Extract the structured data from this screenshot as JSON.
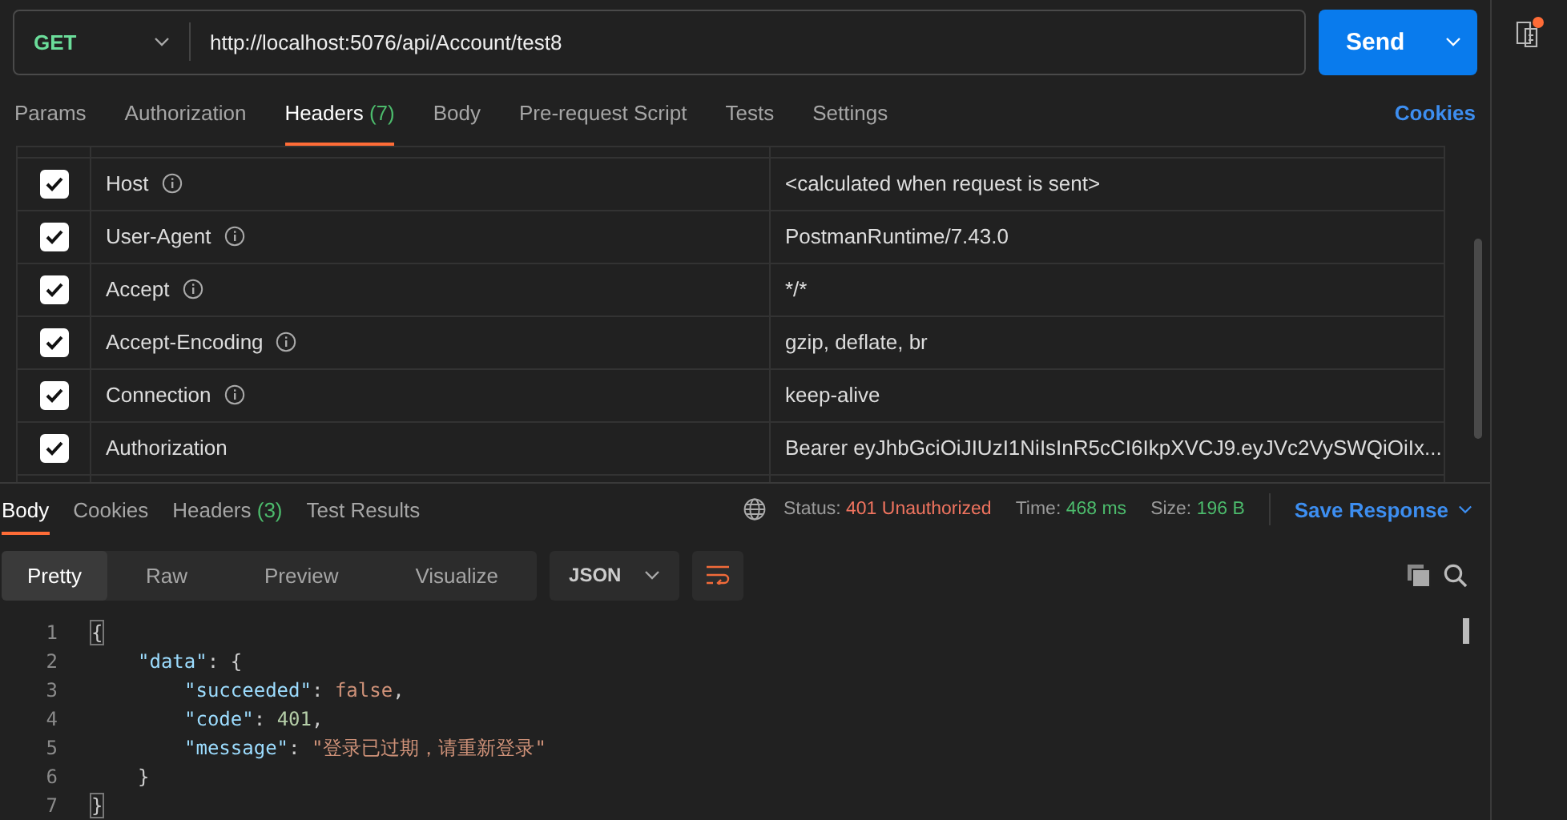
{
  "request": {
    "method": "GET",
    "url": "http://localhost:5076/api/Account/test8",
    "send_label": "Send"
  },
  "request_tabs": [
    {
      "label": "Params",
      "selected": false
    },
    {
      "label": "Authorization",
      "selected": false
    },
    {
      "label": "Headers",
      "count": "(7)",
      "selected": true
    },
    {
      "label": "Body",
      "selected": false
    },
    {
      "label": "Pre-request Script",
      "selected": false
    },
    {
      "label": "Tests",
      "selected": false
    },
    {
      "label": "Settings",
      "selected": false
    }
  ],
  "cookies_link": "Cookies",
  "headers": [
    {
      "key": "Host",
      "info": true,
      "value": "<calculated when request is sent>",
      "checked": true
    },
    {
      "key": "User-Agent",
      "info": true,
      "value": "PostmanRuntime/7.43.0",
      "checked": true
    },
    {
      "key": "Accept",
      "info": true,
      "value": "*/*",
      "checked": true
    },
    {
      "key": "Accept-Encoding",
      "info": true,
      "value": "gzip, deflate, br",
      "checked": true
    },
    {
      "key": "Connection",
      "info": true,
      "value": "keep-alive",
      "checked": true
    },
    {
      "key": "Authorization",
      "info": false,
      "value": "Bearer eyJhbGciOiJIUzI1NiIsInR5cCI6IkpXVCJ9.eyJVc2VySWQiOiIx...",
      "checked": true
    }
  ],
  "response_tabs": [
    {
      "label": "Body",
      "selected": true
    },
    {
      "label": "Cookies",
      "selected": false
    },
    {
      "label": "Headers",
      "count": "(3)",
      "selected": false
    },
    {
      "label": "Test Results",
      "selected": false
    }
  ],
  "response_meta": [
    {
      "label": "Status:",
      "value": "401 Unauthorized",
      "kind": "error"
    },
    {
      "label": "Time:",
      "value": "468 ms",
      "kind": "ok"
    },
    {
      "label": "Size:",
      "value": "196 B",
      "kind": "ok"
    }
  ],
  "save_response": "Save Response",
  "view_modes": [
    {
      "label": "Pretty",
      "selected": true
    },
    {
      "label": "Raw",
      "selected": false
    },
    {
      "label": "Preview",
      "selected": false
    },
    {
      "label": "Visualize",
      "selected": false
    }
  ],
  "format": "JSON",
  "code": [
    {
      "number": "1",
      "tokens": [
        {
          "kind": "open",
          "text": "{",
          "matched": true
        }
      ]
    },
    {
      "number": "2",
      "tokens": [
        {
          "kind": "key",
          "text": "\"data\""
        },
        {
          "kind": "punct",
          "text": ": "
        },
        {
          "kind": "open",
          "text": "{",
          "matched": false
        }
      ]
    },
    {
      "number": "3",
      "tokens": [
        {
          "kind": "key",
          "text": "\"succeeded\""
        },
        {
          "kind": "punct",
          "text": ": "
        },
        {
          "kind": "bool",
          "text": "false"
        },
        {
          "kind": "punct",
          "text": ","
        }
      ]
    },
    {
      "number": "4",
      "tokens": [
        {
          "kind": "key",
          "text": "\"code\""
        },
        {
          "kind": "punct",
          "text": ": "
        },
        {
          "kind": "number",
          "text": "401"
        },
        {
          "kind": "punct",
          "text": ","
        }
      ]
    },
    {
      "number": "5",
      "tokens": [
        {
          "kind": "key",
          "text": "\"message\""
        },
        {
          "kind": "punct",
          "text": ": "
        },
        {
          "kind": "string",
          "text": "\"登录已过期，请重新登录\""
        }
      ]
    },
    {
      "number": "6",
      "tokens": [
        {
          "kind": "close",
          "text": "}",
          "matched": false
        }
      ]
    },
    {
      "number": "7",
      "tokens": [
        {
          "kind": "close",
          "text": "}",
          "matched": true
        }
      ]
    }
  ]
}
